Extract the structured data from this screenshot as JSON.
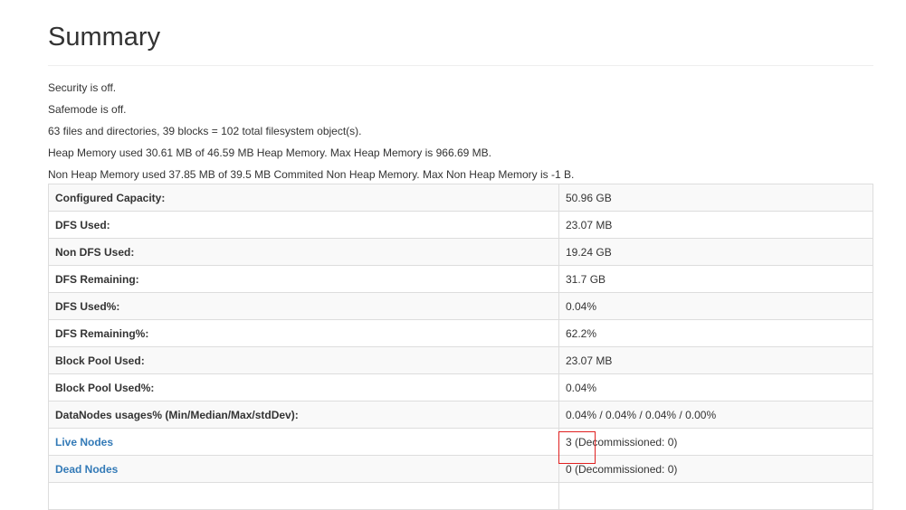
{
  "header": {
    "title": "Summary"
  },
  "info": {
    "security": "Security is off.",
    "safemode": "Safemode is off.",
    "objects": "63 files and directories, 39 blocks = 102 total filesystem object(s).",
    "heap": "Heap Memory used 30.61 MB of 46.59 MB Heap Memory. Max Heap Memory is 966.69 MB.",
    "nonheap": "Non Heap Memory used 37.85 MB of 39.5 MB Commited Non Heap Memory. Max Non Heap Memory is -1 B."
  },
  "table": {
    "rows": [
      {
        "label": "Configured Capacity:",
        "value": "50.96 GB"
      },
      {
        "label": "DFS Used:",
        "value": "23.07 MB"
      },
      {
        "label": "Non DFS Used:",
        "value": "19.24 GB"
      },
      {
        "label": "DFS Remaining:",
        "value": "31.7 GB"
      },
      {
        "label": "DFS Used%:",
        "value": "0.04%"
      },
      {
        "label": "DFS Remaining%:",
        "value": "62.2%"
      },
      {
        "label": "Block Pool Used:",
        "value": "23.07 MB"
      },
      {
        "label": "Block Pool Used%:",
        "value": "0.04%"
      },
      {
        "label": "DataNodes usages% (Min/Median/Max/stdDev):",
        "value": "0.04% / 0.04% / 0.04% / 0.00%"
      },
      {
        "label": "Live Nodes",
        "value": "3 (Decommissioned: 0)"
      },
      {
        "label": "Dead Nodes",
        "value": "0 (Decommissioned: 0)"
      }
    ]
  },
  "colors": {
    "link": "#337ab7",
    "highlight": "#e02020",
    "stripe": "#f9f9f9",
    "border": "#dddddd"
  }
}
